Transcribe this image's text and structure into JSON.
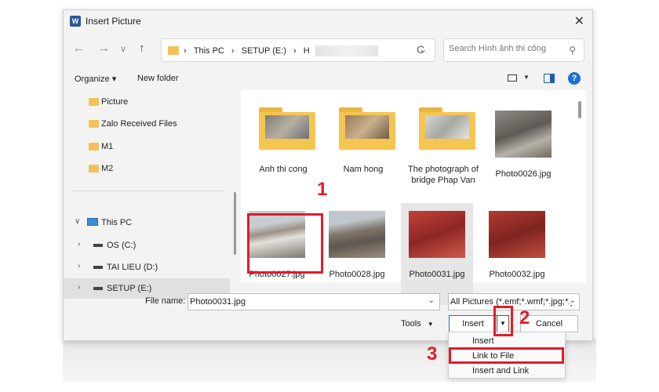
{
  "window": {
    "title": "Insert Picture",
    "app_icon_letter": "W"
  },
  "nav": {
    "back": "←",
    "forward": "→",
    "recent": "∨",
    "up": "↑",
    "address": {
      "crumb_1": "This PC",
      "crumb_2": "SETUP (E:)",
      "crumb_3": "H",
      "separator": "›"
    },
    "refresh": "C",
    "search_placeholder": "Search Hình ảnh thi công"
  },
  "toolbar": {
    "organize": "Organize ▾",
    "new_folder": "New folder",
    "help": "?"
  },
  "sidebar": {
    "items": [
      {
        "label": "Picture"
      },
      {
        "label": "Zalo Received Files"
      },
      {
        "label": "M1"
      },
      {
        "label": "M2"
      }
    ],
    "this_pc": "This PC",
    "drives": [
      {
        "label": "OS (C:)"
      },
      {
        "label": "TAI LIEU (D:)"
      },
      {
        "label": "SETUP (E:)"
      }
    ],
    "expanded_chevron": "∨",
    "collapsed_chevron": "›"
  },
  "files": {
    "folders": [
      {
        "name": "Anh thi cong"
      },
      {
        "name": "Nam hong"
      },
      {
        "name": "The photograph of bridge Phap Van"
      }
    ],
    "photos": [
      {
        "name": "Photo0026.jpg"
      },
      {
        "name": "Photo0027.jpg"
      },
      {
        "name": "Photo0028.jpg"
      },
      {
        "name": "Photo0031.jpg"
      },
      {
        "name": "Photo0032.jpg"
      }
    ]
  },
  "bottom": {
    "file_name_label": "File name:",
    "file_name_value": "Photo0031.jpg",
    "filter_value": "All Pictures (*.emf;*.wmf;*.jpg;*.j",
    "tools_label": "Tools",
    "insert_label": "Insert",
    "cancel_label": "Cancel"
  },
  "insert_menu": {
    "items": [
      {
        "label": "Insert"
      },
      {
        "label": "Link to File"
      },
      {
        "label": "Insert and Link"
      }
    ]
  },
  "annotations": {
    "step_1": "1",
    "step_2": "2",
    "step_3": "3",
    "highlight_color": "#e21b2b"
  },
  "colors": {
    "accent": "#1f6fd1",
    "folder": "#f5c552",
    "selection": "#e6e6e6"
  }
}
